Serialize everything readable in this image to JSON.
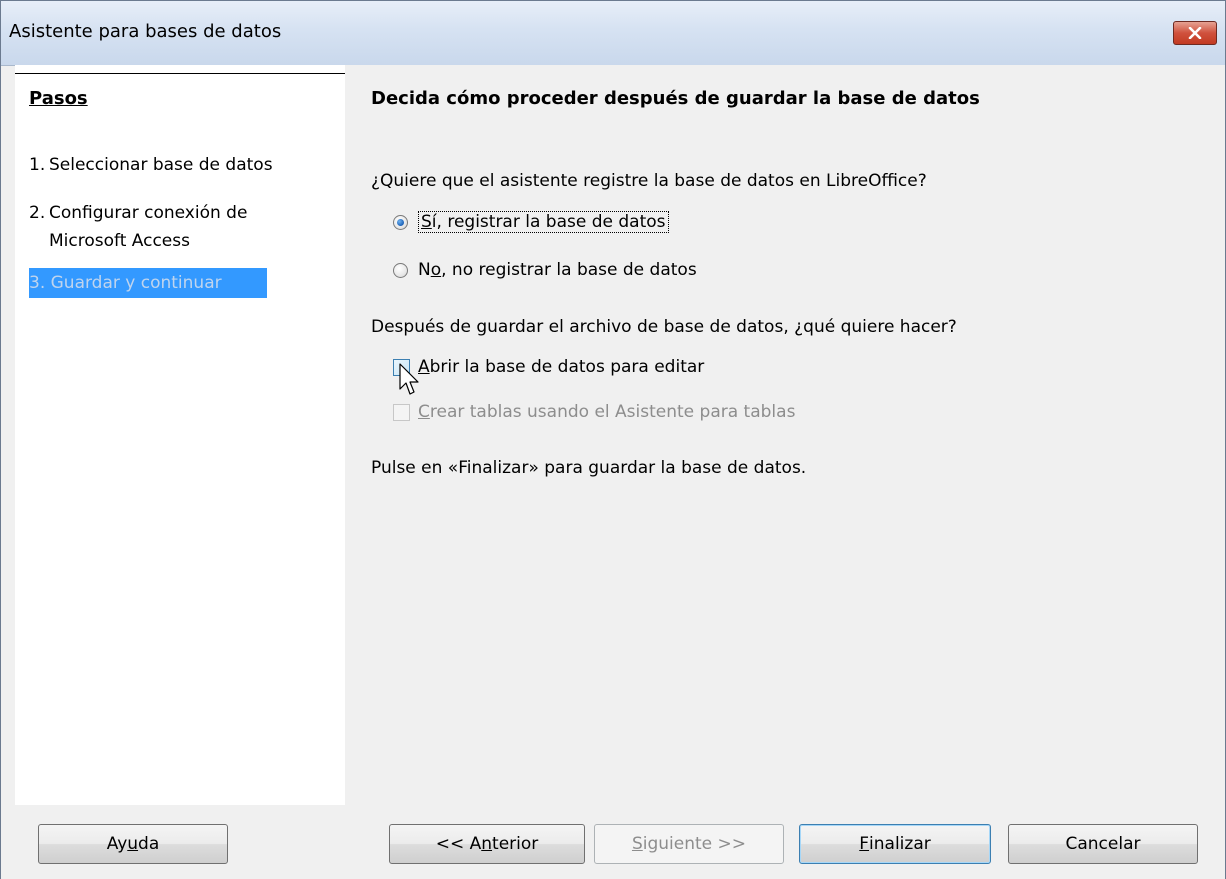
{
  "window": {
    "title": "Asistente para bases de datos"
  },
  "sidebar": {
    "heading": "Pasos",
    "steps": [
      {
        "num": "1.",
        "label": "Seleccionar base de datos"
      },
      {
        "num": "2.",
        "label_line1": "Configurar conexión de",
        "label_line2": "Microsoft Access"
      },
      {
        "label": "3. Guardar y continuar",
        "active": true
      }
    ]
  },
  "main": {
    "heading": "Decida cómo proceder después de guardar la base de datos",
    "register_question": "¿Quiere que el asistente registre la base de datos en LibreOffice?",
    "register_yes": {
      "accel": "S",
      "rest": "í, registrar la base de datos",
      "checked": true
    },
    "register_no": {
      "pre": "N",
      "accel": "o",
      "rest": ", no registrar la base de datos",
      "checked": false
    },
    "after_question": "Después de guardar el archivo de base de datos, ¿qué quiere hacer?",
    "open_edit": {
      "accel": "A",
      "rest": "brir la base de datos para editar",
      "checked": false
    },
    "create_tables": {
      "accel": "C",
      "rest": "rear tablas usando el Asistente para tablas",
      "checked": false,
      "enabled": false
    },
    "finish_hint": "Pulse en «Finalizar» para guardar la base de datos."
  },
  "footer": {
    "help": {
      "pre": "Ay",
      "accel": "u",
      "rest": "da"
    },
    "back": {
      "pre": "<< A",
      "accel": "n",
      "rest": "terior"
    },
    "next": {
      "accel": "S",
      "rest": "iguiente >>",
      "enabled": false
    },
    "finish": {
      "accel": "F",
      "rest": "inalizar",
      "default": true
    },
    "cancel": "Cancelar"
  },
  "colors": {
    "selection": "#3399ff",
    "close_button": "#c23a22"
  }
}
